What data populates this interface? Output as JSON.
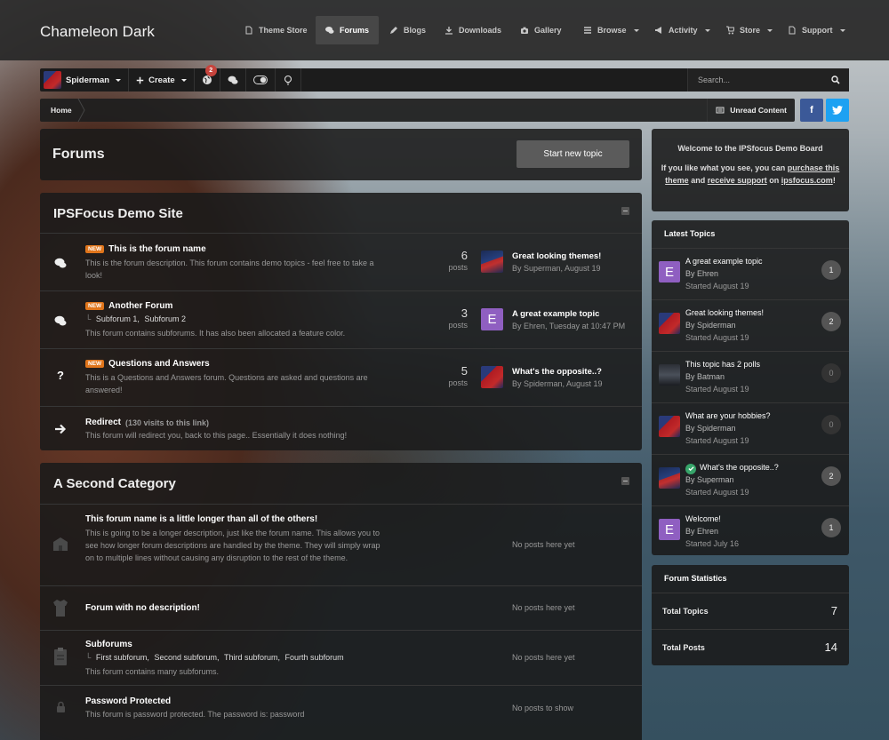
{
  "site": {
    "title": "Chameleon Dark"
  },
  "nav": [
    {
      "label": "Theme Store",
      "icon": "document-icon"
    },
    {
      "label": "Forums",
      "icon": "comments-icon",
      "active": true
    },
    {
      "label": "Blogs",
      "icon": "pencil-icon"
    },
    {
      "label": "Downloads",
      "icon": "download-icon"
    },
    {
      "label": "Gallery",
      "icon": "camera-icon"
    },
    {
      "label": "Browse",
      "icon": "list-icon"
    },
    {
      "label": "Activity",
      "icon": "bullhorn-icon"
    },
    {
      "label": "Store",
      "icon": "cart-icon"
    },
    {
      "label": "Support",
      "icon": "document-icon"
    }
  ],
  "userbar": {
    "user": "Spiderman",
    "create": "Create",
    "notif_count": "2"
  },
  "search": {
    "placeholder": "Search..."
  },
  "breadcrumb": {
    "home": "Home",
    "unread": "Unread Content",
    "facebook": "f"
  },
  "page": {
    "title": "Forums",
    "start_topic": "Start new topic"
  },
  "categories": [
    {
      "title": "IPSFocus Demo Site",
      "forums": [
        {
          "new": "NEW",
          "name": "This is the forum name",
          "desc": "This is the forum description. This forum contains demo topics - feel free to take a look!",
          "posts": "6",
          "posts_label": "posts",
          "last_title": "Great looking themes!",
          "last_by": "By Superman, August 19"
        },
        {
          "new": "NEW",
          "name": "Another Forum",
          "subforums": [
            "Subforum 1,",
            "Subforum 2"
          ],
          "desc": "This forum contains subforums. It has also been allocated a feature color.",
          "posts": "3",
          "posts_label": "posts",
          "last_title": "A great example topic",
          "last_by": "By Ehren, Tuesday at 10:47 PM",
          "last_avatar_letter": "E"
        },
        {
          "new": "NEW",
          "name": "Questions and Answers",
          "desc": "This is a Questions and Answers forum. Questions are asked and questions are answered!",
          "posts": "5",
          "posts_label": "posts",
          "last_title": "What's the opposite..?",
          "last_by": "By Spiderman, August 19",
          "icon_text": "?"
        },
        {
          "name": "Redirect",
          "redirect_note": "(130 visits to this link)",
          "desc": "This forum will redirect you, back to this page.. Essentially it does nothing!"
        }
      ]
    },
    {
      "title": "A Second Category",
      "forums": [
        {
          "name": "This forum name is a little longer than all of the others!",
          "desc": "This is going to be a longer description, just like the forum name. This allows you to see how longer forum descriptions are handled by the theme. They will simply wrap on to multiple lines without causing any disruption to the rest of the theme.",
          "status": "No posts here yet"
        },
        {
          "name": "Forum with no description!",
          "status": "No posts here yet"
        },
        {
          "name": "Subforums",
          "subforums": [
            "First subforum,",
            "Second subforum,",
            "Third subforum,",
            "Fourth subforum"
          ],
          "desc": "This forum contains many subforums.",
          "status": "No posts here yet"
        },
        {
          "name": "Password Protected",
          "desc": "This forum is password protected. The password is: password",
          "status": "No posts to show"
        }
      ]
    }
  ],
  "welcome": {
    "line1": "Welcome to the IPSfocus Demo Board",
    "line2a": "If you like what you see, you can",
    "link1": "purchase this theme",
    "line2b": "and",
    "link2": "receive support",
    "line2c": "on",
    "link3": "ipsfocus.com",
    "line2d": "!"
  },
  "latest": {
    "title": "Latest Topics",
    "items": [
      {
        "title": "A great example topic",
        "by": "By Ehren",
        "date": "Started August 19",
        "count": "1",
        "avatar_letter": "E"
      },
      {
        "title": "Great looking themes!",
        "by": "By Spiderman",
        "date": "Started August 19",
        "count": "2"
      },
      {
        "title": "This topic has 2 polls",
        "by": "By Batman",
        "date": "Started August 19",
        "count": "0"
      },
      {
        "title": "What are your hobbies?",
        "by": "By Spiderman",
        "date": "Started August 19",
        "count": "0"
      },
      {
        "title": "What's the opposite..?",
        "by": "By Superman",
        "date": "Started August 19",
        "count": "2"
      },
      {
        "title": "Welcome!",
        "by": "By Ehren",
        "date": "Started July 16",
        "count": "1",
        "avatar_letter": "E"
      }
    ]
  },
  "stats": {
    "title": "Forum Statistics",
    "rows": [
      {
        "label": "Total Topics",
        "value": "7"
      },
      {
        "label": "Total Posts",
        "value": "14"
      }
    ]
  },
  "colors": {
    "accent_new": "#e0751b",
    "badge_red": "#c7443d",
    "facebook": "#3b5998",
    "twitter": "#1da1f2",
    "solved_green": "#37a56a"
  }
}
